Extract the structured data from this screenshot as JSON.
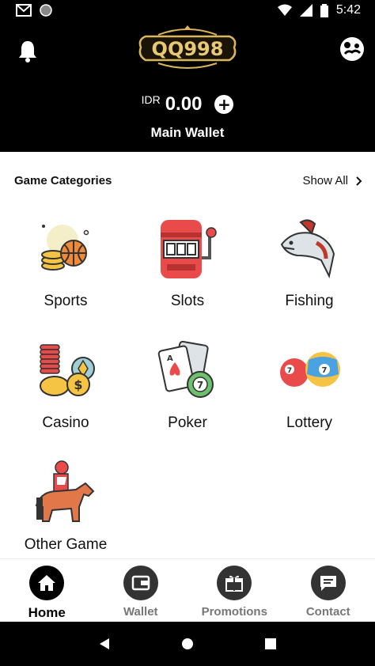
{
  "status_bar": {
    "time": "5:42"
  },
  "header": {
    "logo_text": "QQ998",
    "currency": "IDR",
    "balance": "0.00",
    "wallet_name": "Main Wallet"
  },
  "categories": {
    "title": "Game Categories",
    "show_all": "Show All",
    "items": [
      {
        "label": "Sports"
      },
      {
        "label": "Slots"
      },
      {
        "label": "Fishing"
      },
      {
        "label": "Casino"
      },
      {
        "label": "Poker"
      },
      {
        "label": "Lottery"
      },
      {
        "label": "Other Game"
      }
    ]
  },
  "bottom_nav": {
    "items": [
      {
        "label": "Home",
        "icon": "home-icon",
        "active": true
      },
      {
        "label": "Wallet",
        "icon": "wallet-icon"
      },
      {
        "label": "Promotions",
        "icon": "gift-icon"
      },
      {
        "label": "Contact",
        "icon": "chat-icon"
      }
    ]
  },
  "colors": {
    "header_bg": "#000000",
    "content_bg": "#ffffff",
    "logo_gold": "#d9b65c"
  }
}
